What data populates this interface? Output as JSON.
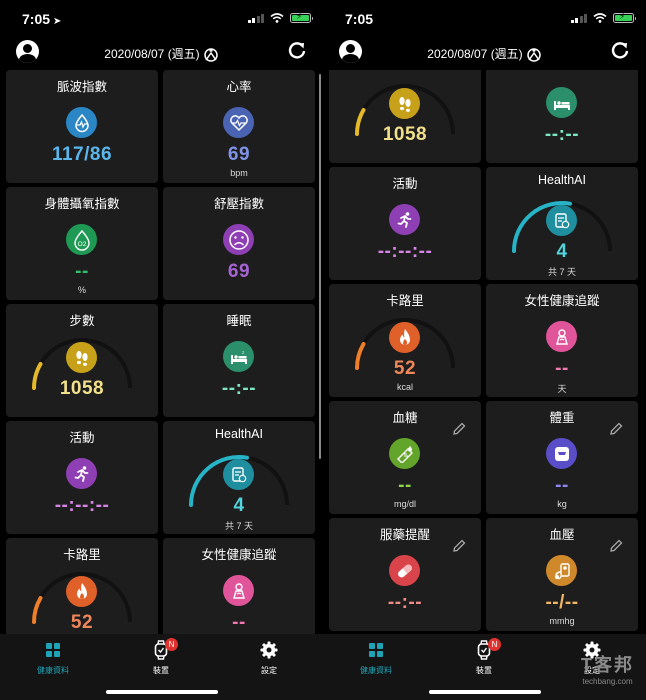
{
  "status": {
    "time_left": "7:05",
    "time_right": "7:05"
  },
  "header": {
    "date": "2020/08/07 (週五)"
  },
  "cards": {
    "pulse": {
      "title": "脈波指數",
      "value": "117/86"
    },
    "heart": {
      "title": "心率",
      "value": "69",
      "unit": "bpm"
    },
    "spo2": {
      "title": "身體攝氧指數",
      "value": "--",
      "unit": "%",
      "icon_text": "O2"
    },
    "stress": {
      "title": "舒壓指數",
      "value": "69"
    },
    "steps": {
      "title": "步數",
      "value": "1058",
      "progress": 0.1
    },
    "sleep": {
      "title": "睡眠",
      "value": "--:--"
    },
    "activity": {
      "title": "活動",
      "value": "--:--:--"
    },
    "healthai": {
      "title": "HealthAI",
      "value": "4",
      "unit": "共 7 天",
      "progress": 0.57
    },
    "calories": {
      "title": "卡路里",
      "value": "52",
      "unit": "kcal",
      "progress": 0.1
    },
    "female": {
      "title": "女性健康追蹤",
      "value": "--",
      "unit": "天"
    },
    "glucose": {
      "title": "血糖",
      "value": "--",
      "unit": "mg/dl"
    },
    "weight": {
      "title": "體重",
      "value": "--",
      "unit": "kg"
    },
    "medication": {
      "title": "服藥提醒",
      "value": "--:--"
    },
    "bp": {
      "title": "血壓",
      "value": "--/--",
      "unit": "mmhg"
    }
  },
  "colors": {
    "pulse": "#2a86c4",
    "heart": "#4a63b3",
    "spo2": "#1f9a55",
    "stress": "#8e3fb3",
    "steps": "#c8a11a",
    "sleep": "#2a8f6a",
    "activity": "#8e3fb3",
    "healthai": "#1f8fa0",
    "calories": "#e0602a",
    "female": "#e0559a",
    "glucose": "#63a52a",
    "weight": "#5a4ec8",
    "medication": "#d9434a",
    "bp": "#d0892a",
    "accent": "#1fa3b6"
  },
  "value_colors": {
    "pulse": "#5bb6ec",
    "heart": "#7f93e6",
    "spo2": "#33c06c",
    "stress": "#a664d3",
    "steps": "#f3e08a",
    "sleep": "#7ce6c0",
    "activity": "#d685e6",
    "healthai": "#52d4dc",
    "calories": "#f0875a",
    "female": "#f277b2",
    "glucose": "#8ed348",
    "weight": "#8f86ef",
    "medication": "#f08c84",
    "bp": "#f0b760"
  },
  "tabbar": {
    "tab1": "健康資料",
    "tab2": "裝置",
    "tab3": "設定",
    "badge": "N"
  },
  "watermark": {
    "line1": "T客邦",
    "line2": "techbang.com"
  }
}
